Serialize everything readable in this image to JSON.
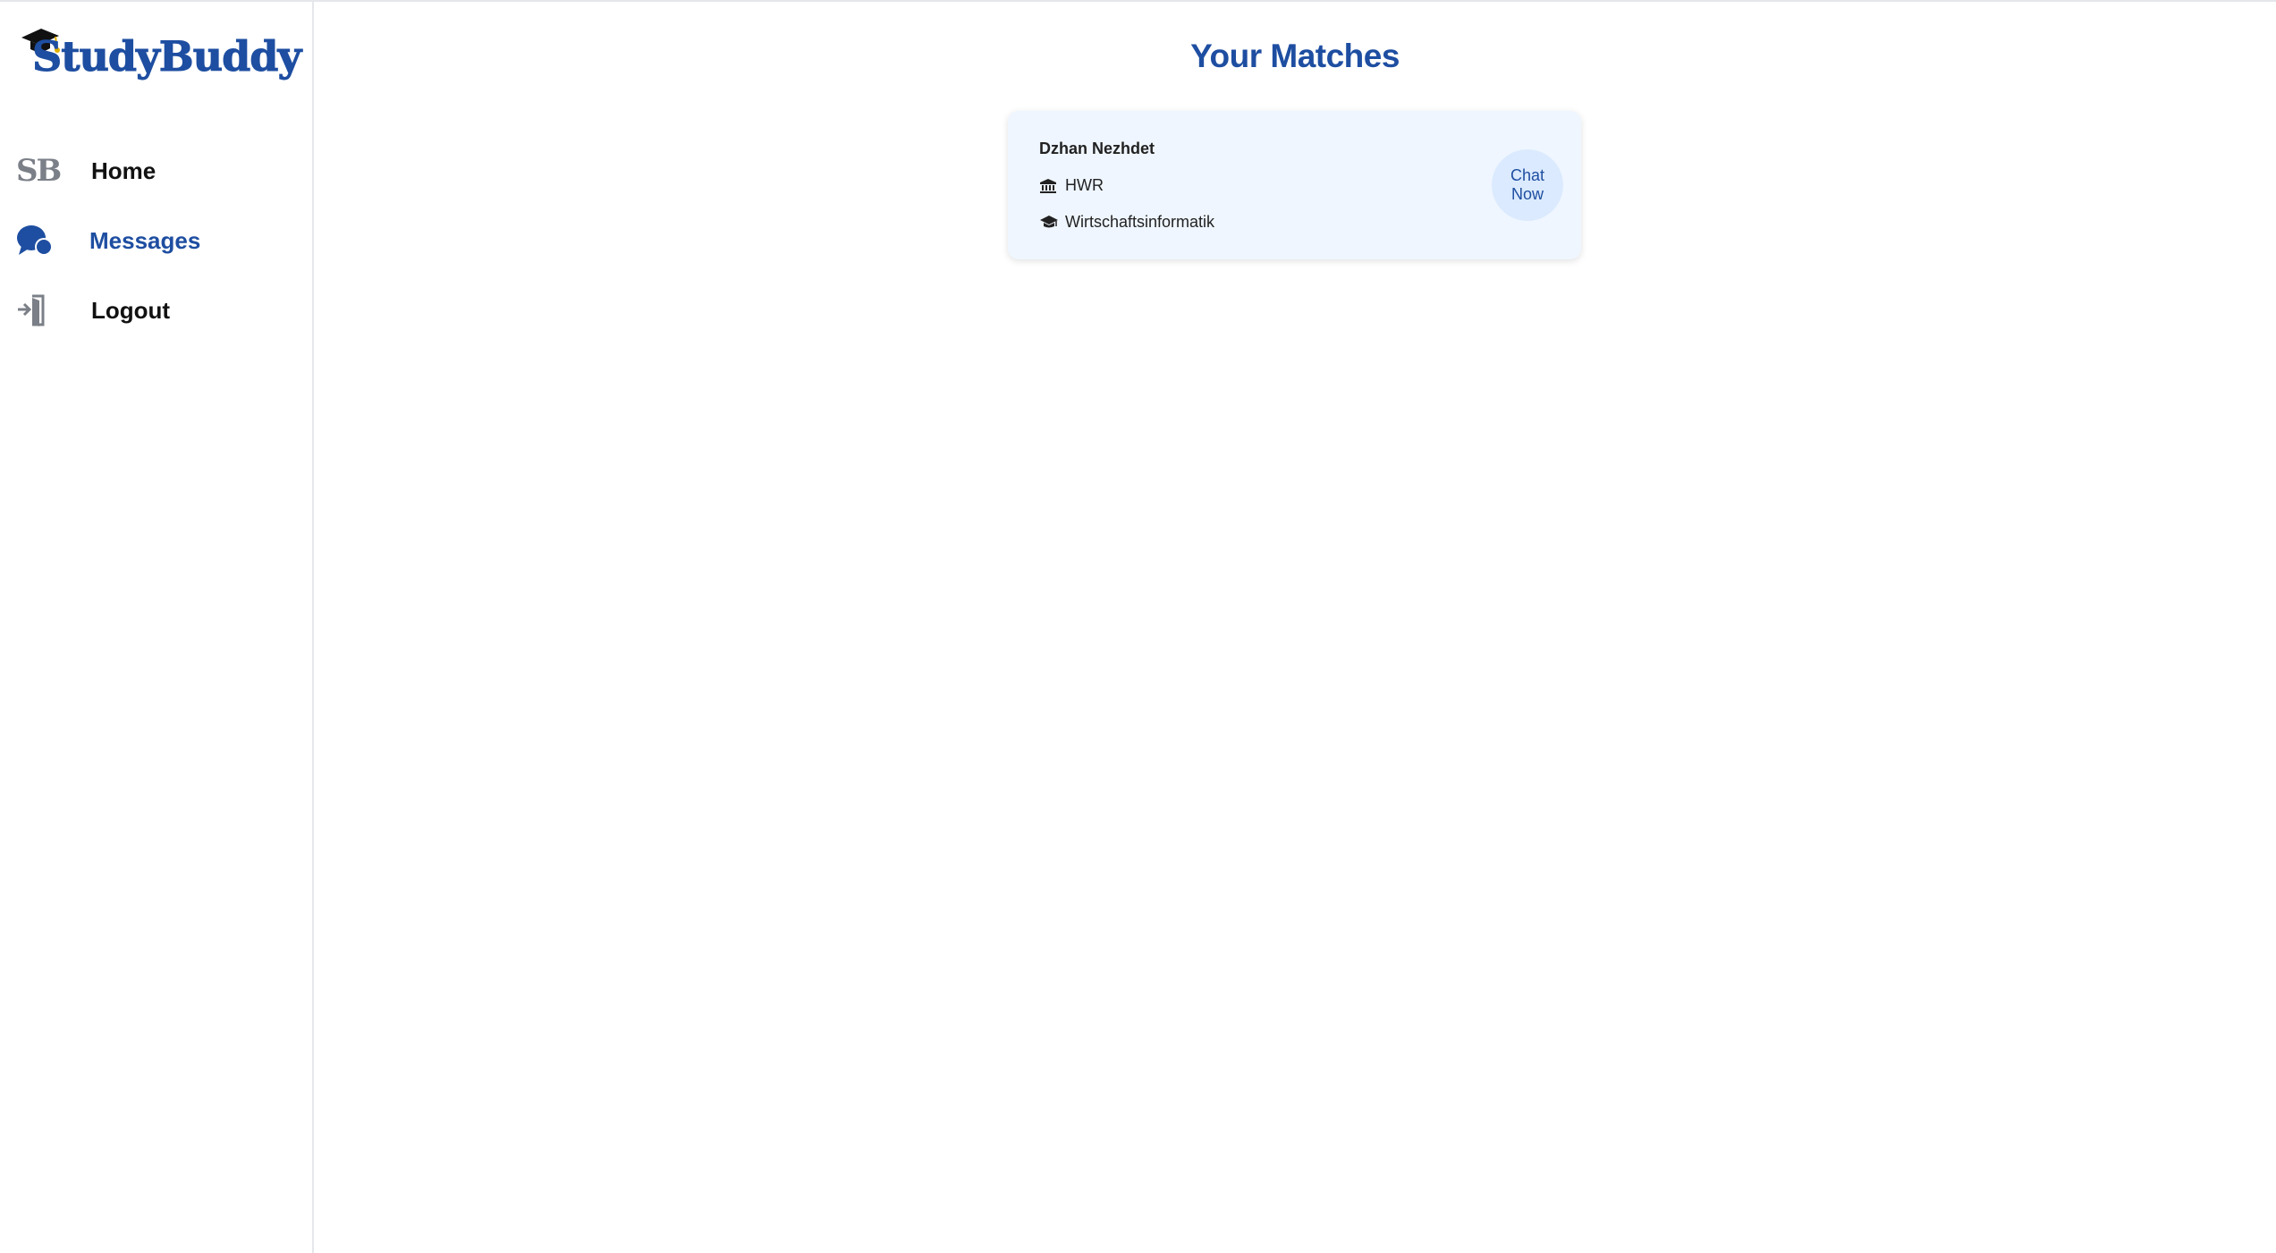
{
  "app": {
    "logo_text": "StudyBuddy"
  },
  "sidebar": {
    "items": [
      {
        "label": "Home",
        "icon": "sb-logo-icon",
        "active": false
      },
      {
        "label": "Messages",
        "icon": "chat-bubbles-icon",
        "active": true
      },
      {
        "label": "Logout",
        "icon": "logout-door-icon",
        "active": false
      }
    ],
    "home_glyph": "SB"
  },
  "main": {
    "title": "Your Matches",
    "matches": [
      {
        "name": "Dzhan Nezhdet",
        "university": "HWR",
        "course": "Wirtschaftsinformatik",
        "chat_label_line1": "Chat",
        "chat_label_line2": "Now"
      }
    ]
  },
  "colors": {
    "brand": "#1e4ea1",
    "card_bg": "#eff6ff",
    "chat_button_bg": "#dbeafe",
    "icon_gray": "#7b7f87"
  }
}
